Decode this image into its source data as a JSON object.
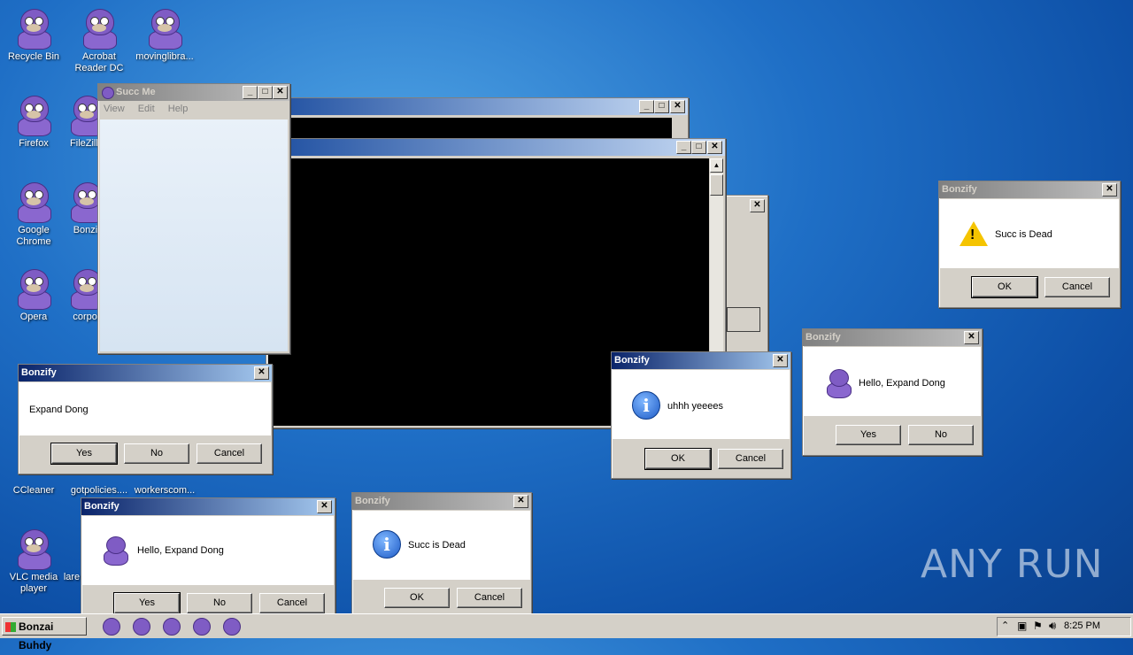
{
  "desktop": {
    "icons": [
      {
        "label": "Recycle Bin"
      },
      {
        "label": "Acrobat Reader DC"
      },
      {
        "label": "movinglibra..."
      },
      {
        "label": "Firefox"
      },
      {
        "label": "FileZilla"
      },
      {
        "label": "Google Chrome"
      },
      {
        "label": "Bonzif"
      },
      {
        "label": "Opera"
      },
      {
        "label": "corpor"
      },
      {
        "label": "CCleaner"
      },
      {
        "label": "gotpolicies...."
      },
      {
        "label": "workerscom..."
      },
      {
        "label": "VLC media player"
      },
      {
        "label": "lare"
      }
    ]
  },
  "succ_window": {
    "title": "Succ Me",
    "menu": [
      "View",
      "Edit",
      "Help"
    ]
  },
  "dialogs": {
    "expand_dong_1": {
      "title": "Bonzify",
      "text": "Expand Dong",
      "buttons": [
        "Yes",
        "No",
        "Cancel"
      ]
    },
    "hello_1": {
      "title": "Bonzify",
      "text": "Hello, Expand Dong",
      "buttons": [
        "Yes",
        "No",
        "Cancel"
      ]
    },
    "succ_dead_info": {
      "title": "Bonzify",
      "text": "Succ is Dead",
      "buttons": [
        "OK",
        "Cancel"
      ]
    },
    "uhhh": {
      "title": "Bonzify",
      "text": "uhhh yeeees",
      "buttons": [
        "OK",
        "Cancel"
      ]
    },
    "hello_2": {
      "title": "Bonzify",
      "text": "Hello, Expand Dong",
      "buttons": [
        "Yes",
        "No"
      ]
    },
    "succ_dead_warn": {
      "title": "Bonzify",
      "text": "Succ is Dead",
      "buttons": [
        "OK",
        "Cancel"
      ]
    }
  },
  "taskbar": {
    "start_label": "Bonzai Buhdy",
    "clock": "8:25 PM"
  },
  "watermark": "ANY RUN"
}
